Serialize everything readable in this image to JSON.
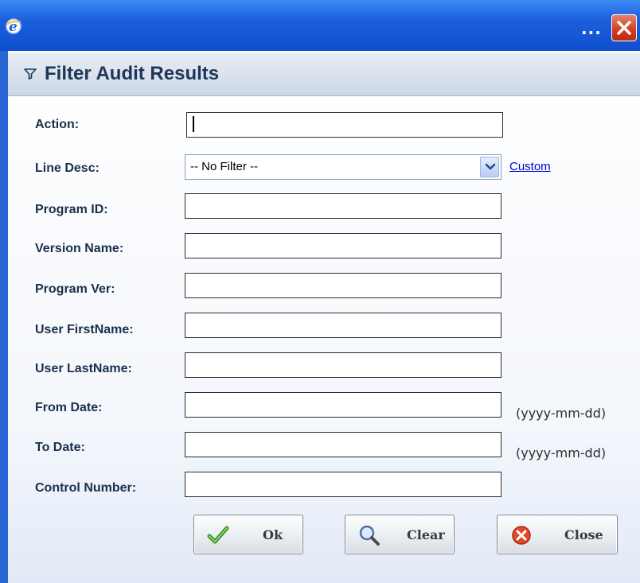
{
  "window": {
    "browser_icon": "internet-explorer-icon",
    "title_overflow": "...",
    "close_icon": "close-icon"
  },
  "panel": {
    "title": "Filter Audit Results",
    "header_icon": "funnel-icon"
  },
  "form": {
    "action": {
      "label": "Action:",
      "value": ""
    },
    "line_desc": {
      "label": "Line Desc:",
      "selected": "-- No Filter --",
      "custom_link": "Custom"
    },
    "program_id": {
      "label": "Program ID:",
      "value": ""
    },
    "version_name": {
      "label": "Version Name:",
      "value": ""
    },
    "program_ver": {
      "label": "Program Ver:",
      "value": ""
    },
    "user_firstname": {
      "label": "User FirstName:",
      "value": ""
    },
    "user_lastname": {
      "label": "User LastName:",
      "value": ""
    },
    "from_date": {
      "label": "From Date:",
      "value": "",
      "hint": "(yyyy-mm-dd)"
    },
    "to_date": {
      "label": "To Date:",
      "value": "",
      "hint": "(yyyy-mm-dd)"
    },
    "control_number": {
      "label": "Control Number:",
      "value": ""
    }
  },
  "buttons": {
    "ok": {
      "label": "Ok",
      "icon": "checkmark-icon"
    },
    "clear": {
      "label": "Clear",
      "icon": "magnifier-icon"
    },
    "close": {
      "label": "Close",
      "icon": "close-circle-icon"
    }
  },
  "colors": {
    "titlebar": "#1c5fdc",
    "panel_header_text": "#1e3657",
    "link": "#0000cc"
  }
}
